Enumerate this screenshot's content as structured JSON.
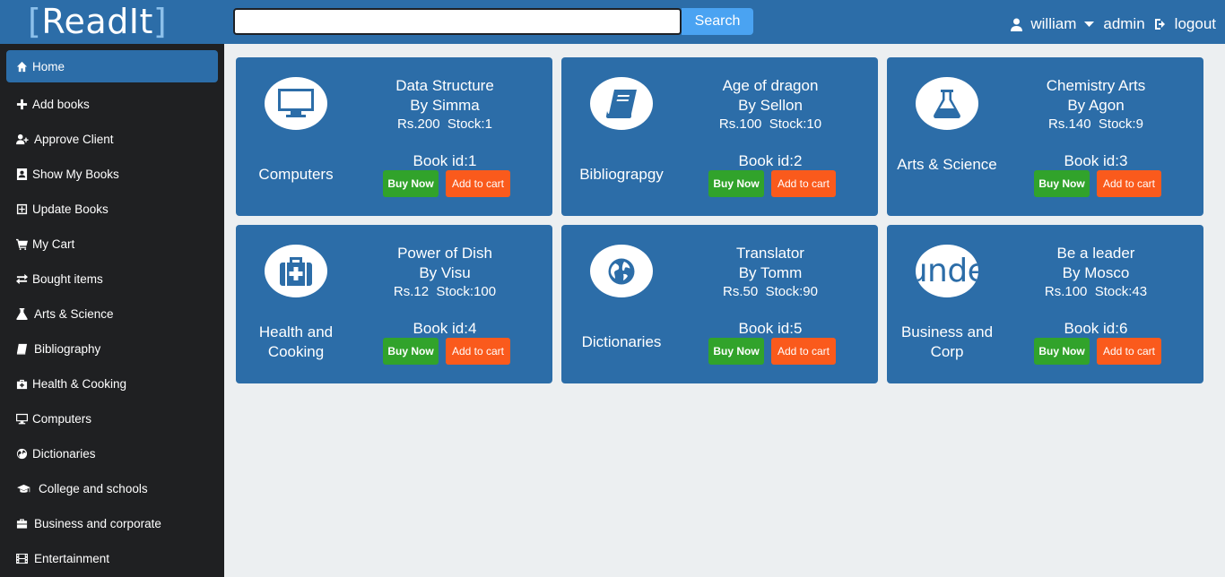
{
  "header": {
    "logo_text": "ReadIt",
    "logo_bracket_open": "[",
    "logo_bracket_close": "]",
    "search_value": "",
    "search_button": "Search",
    "user_name": "william",
    "role_menu": "admin",
    "logout": "logout"
  },
  "sidebar": {
    "items": [
      {
        "label": "Home",
        "icon": "home-icon",
        "active": true
      },
      {
        "label": "Add books",
        "icon": "plus-icon"
      },
      {
        "label": "Approve Client",
        "icon": "user-plus-icon"
      },
      {
        "label": "Show My Books",
        "icon": "book-user-icon"
      },
      {
        "label": "Update Books",
        "icon": "plus-square-icon"
      },
      {
        "label": "My Cart",
        "icon": "cart-icon"
      },
      {
        "label": "Bought items",
        "icon": "exchange-icon"
      },
      {
        "label": "Arts & Science",
        "icon": "flask-icon"
      },
      {
        "label": "Bibliography",
        "icon": "book-icon"
      },
      {
        "label": "Health & Cooking",
        "icon": "medkit-icon"
      },
      {
        "label": "Computers",
        "icon": "desktop-icon"
      },
      {
        "label": "Dictionaries",
        "icon": "globe-icon"
      },
      {
        "label": "College and schools",
        "icon": "graduation-cap-icon"
      },
      {
        "label": "Business and corporate",
        "icon": "briefcase-icon"
      },
      {
        "label": "Entertainment",
        "icon": "film-icon"
      }
    ]
  },
  "books": [
    {
      "category": "Computers",
      "title": "Data Structure",
      "author": "By Simma",
      "price": "Rs.200",
      "stock": "Stock:1",
      "book_id": "Book id:1",
      "buy": "Buy Now",
      "cart": "Add to cart",
      "icon": "desktop-icon"
    },
    {
      "category": "Bibliograpgy",
      "title": "Age of dragon",
      "author": "By Sellon",
      "price": "Rs.100",
      "stock": "Stock:10",
      "book_id": "Book id:2",
      "buy": "Buy Now",
      "cart": "Add to cart",
      "icon": "book-icon"
    },
    {
      "category": "Arts & Science",
      "title": "Chemistry Arts",
      "author": "By Agon",
      "price": "Rs.140",
      "stock": "Stock:9",
      "book_id": "Book id:3",
      "buy": "Buy Now",
      "cart": "Add to cart",
      "icon": "flask-icon"
    },
    {
      "category": "Health and Cooking",
      "title": "Power of Dish",
      "author": "By Visu",
      "price": "Rs.12",
      "stock": "Stock:100",
      "book_id": "Book id:4",
      "buy": "Buy Now",
      "cart": "Add to cart",
      "icon": "medkit-icon"
    },
    {
      "category": "Dictionaries",
      "title": "Translator",
      "author": "By Tomm",
      "price": "Rs.50",
      "stock": "Stock:90",
      "book_id": "Book id:5",
      "buy": "Buy Now",
      "cart": "Add to cart",
      "icon": "globe-icon"
    },
    {
      "category": "Business and Corp",
      "title": "Be a leader",
      "author": "By Mosco",
      "price": "Rs.100",
      "stock": "Stock:43",
      "book_id": "Book id:6",
      "buy": "Buy Now",
      "cart": "Add to cart",
      "icon": "broken-glyph-icon",
      "icon_text": "unde"
    }
  ],
  "colors": {
    "brand": "#2c6da8",
    "buy": "#31a32b",
    "cart": "#fa5a1c",
    "search": "#4aa3f2",
    "sidebar": "#1f2022"
  }
}
